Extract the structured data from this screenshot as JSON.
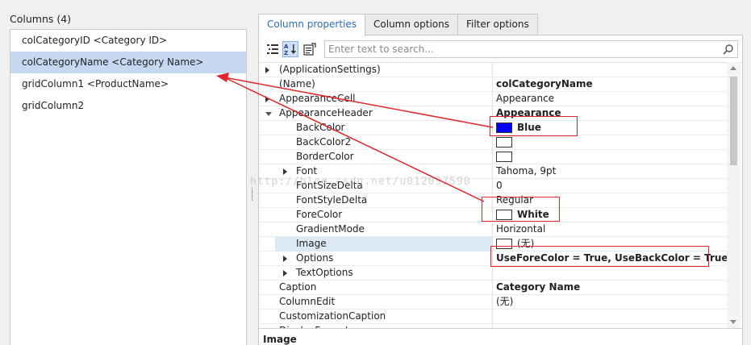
{
  "columns": {
    "title": "Columns (4)",
    "items": [
      {
        "label": "colCategoryID <Category ID>",
        "selected": false
      },
      {
        "label": "colCategoryName <Category Name>",
        "selected": true
      },
      {
        "label": "gridColumn1 <ProductName>",
        "selected": false
      },
      {
        "label": "gridColumn2",
        "selected": false
      }
    ]
  },
  "tabs": [
    {
      "label": "Column properties",
      "active": true
    },
    {
      "label": "Column options",
      "active": false
    },
    {
      "label": "Filter options",
      "active": false
    }
  ],
  "toolbar": {
    "search_placeholder": "Enter text to search...",
    "icons": [
      "categorized-icon",
      "alphabetical-sort-icon",
      "property-pages-icon",
      "search-icon"
    ]
  },
  "properties": [
    {
      "name": "(ApplicationSettings)",
      "value": "",
      "indent": 0,
      "expander": "collapsed"
    },
    {
      "name": "(Name)",
      "value": "colCategoryName",
      "indent": 0,
      "bold": true
    },
    {
      "name": "AppearanceCell",
      "value": "Appearance",
      "indent": 0,
      "expander": "collapsed"
    },
    {
      "name": "AppearanceHeader",
      "value": "Appearance",
      "indent": 0,
      "expander": "expanded",
      "bold": true
    },
    {
      "name": "BackColor",
      "value": "Blue",
      "indent": 1,
      "bold": true,
      "swatch": "#0000ff"
    },
    {
      "name": "BackColor2",
      "value": "",
      "indent": 1,
      "swatch": "#ffffff"
    },
    {
      "name": "BorderColor",
      "value": "",
      "indent": 1,
      "swatch": "#ffffff"
    },
    {
      "name": "Font",
      "value": "Tahoma, 9pt",
      "indent": 1,
      "expander": "collapsed"
    },
    {
      "name": "FontSizeDelta",
      "value": "0",
      "indent": 1
    },
    {
      "name": "FontStyleDelta",
      "value": "Regular",
      "indent": 1
    },
    {
      "name": "ForeColor",
      "value": "White",
      "indent": 1,
      "bold": true,
      "swatch": "#ffffff"
    },
    {
      "name": "GradientMode",
      "value": "Horizontal",
      "indent": 1
    },
    {
      "name": "Image",
      "value": "(无)",
      "indent": 1,
      "swatch": "#ffffff",
      "highlight": true
    },
    {
      "name": "Options",
      "value": "UseForeColor = True, UseBackColor = True",
      "indent": 1,
      "expander": "collapsed",
      "bold": true
    },
    {
      "name": "TextOptions",
      "value": "",
      "indent": 1,
      "expander": "collapsed"
    },
    {
      "name": "Caption",
      "value": "Category Name",
      "indent": 0,
      "bold": true
    },
    {
      "name": "ColumnEdit",
      "value": "(无)",
      "indent": 0
    },
    {
      "name": "CustomizationCaption",
      "value": "",
      "indent": 0
    },
    {
      "name": "DisplayFormat",
      "value": "",
      "indent": 0,
      "expander": "collapsed"
    }
  ],
  "description": {
    "title": "Image"
  },
  "watermark": "http://blog.csdn.net/u012097590",
  "colors": {
    "annotation_red": "#e0262e",
    "selection": "#c6d8ef",
    "tab_active_text": "#2a6ebb"
  }
}
